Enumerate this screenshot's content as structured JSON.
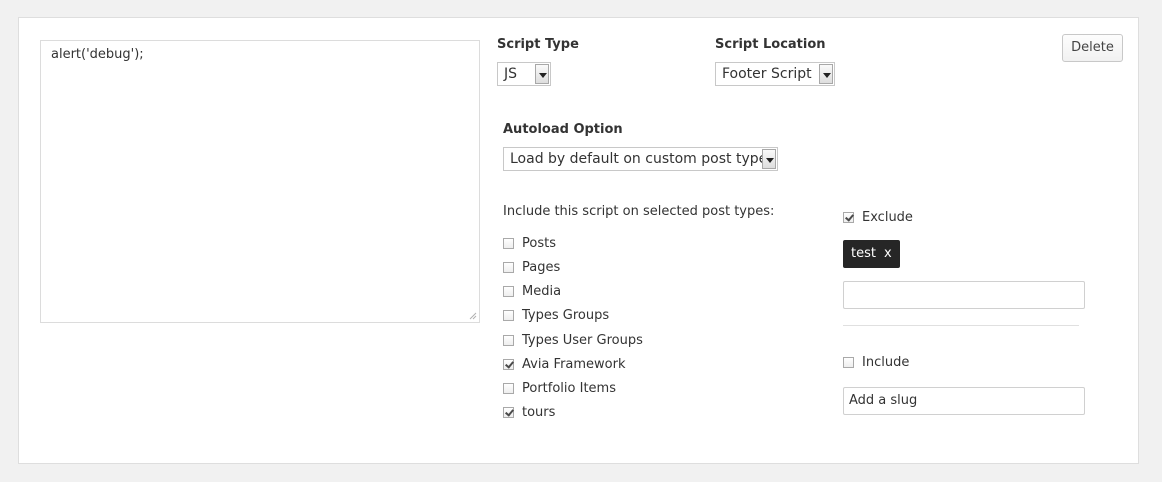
{
  "editor": {
    "code": "alert('debug');"
  },
  "script_type": {
    "label": "Script Type",
    "selected": "JS"
  },
  "script_location": {
    "label": "Script Location",
    "selected": "Footer Script"
  },
  "delete_label": "Delete",
  "autoload": {
    "label": "Autoload Option",
    "selected": "Load by default on custom post types"
  },
  "post_types": {
    "label": "Include this script on selected post types:",
    "items": [
      {
        "label": "Posts",
        "checked": false
      },
      {
        "label": "Pages",
        "checked": false
      },
      {
        "label": "Media",
        "checked": false
      },
      {
        "label": "Types Groups",
        "checked": false
      },
      {
        "label": "Types User Groups",
        "checked": false
      },
      {
        "label": "Avia Framework",
        "checked": true
      },
      {
        "label": "Portfolio Items",
        "checked": false
      },
      {
        "label": "tours",
        "checked": true
      }
    ]
  },
  "exclude": {
    "label": "Exclude",
    "checked": true,
    "tags": [
      {
        "label": "test",
        "remove": "x"
      }
    ],
    "input_value": ""
  },
  "include": {
    "label": "Include",
    "checked": false,
    "input_placeholder": "Add a slug"
  }
}
